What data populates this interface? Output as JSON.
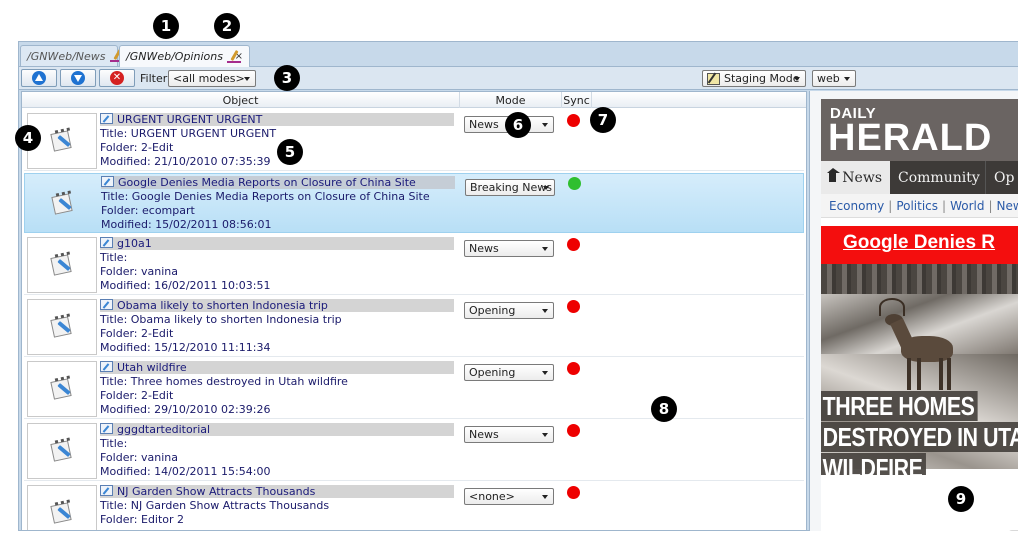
{
  "callouts": [
    "1",
    "2",
    "3",
    "4",
    "5",
    "6",
    "7",
    "8",
    "9"
  ],
  "tabs": [
    {
      "label": "/GNWeb/News",
      "active": false
    },
    {
      "label": "/GNWeb/Opinions",
      "active": true,
      "close": "×"
    }
  ],
  "toolbar": {
    "move_up_icon": "arrow-up-icon",
    "move_down_icon": "arrow-down-icon",
    "stop_icon": "stop-icon",
    "stop_glyph": "✕",
    "filter_label": "Filter:",
    "filter_value": "<all modes>",
    "staging_label": "Staging Mode",
    "channel_value": "web"
  },
  "columns": {
    "object": "Object",
    "mode": "Mode",
    "sync": "Sync"
  },
  "rows": [
    {
      "title": "URGENT URGENT URGENT",
      "title_line": "Title: URGENT URGENT URGENT",
      "folder": "Folder: 2-Edit",
      "modified": "Modified: 21/10/2010 07:35:39",
      "mode": "News",
      "sync": "red",
      "selected": false
    },
    {
      "title": "Google Denies Media Reports on Closure of China Site",
      "title_line": "Title: Google Denies Media Reports on Closure of China Site",
      "folder": "Folder: ecompart",
      "modified": "Modified: 15/02/2011 08:56:01",
      "mode": "Breaking News",
      "sync": "green",
      "selected": true
    },
    {
      "title": "g10a1",
      "title_line": "Title:",
      "folder": "Folder: vanina",
      "modified": "Modified: 16/02/2011 10:03:51",
      "mode": "News",
      "sync": "red",
      "selected": false
    },
    {
      "title": "Obama likely to shorten Indonesia trip",
      "title_line": "Title: Obama likely to shorten Indonesia trip",
      "folder": "Folder: 2-Edit",
      "modified": "Modified: 15/12/2010 11:11:34",
      "mode": "Opening",
      "sync": "red",
      "selected": false
    },
    {
      "title": "Utah wildfire",
      "title_line": "Title: Three homes destroyed in Utah wildfire",
      "folder": "Folder: 2-Edit",
      "modified": "Modified: 29/10/2010 02:39:26",
      "mode": "Opening",
      "sync": "red",
      "selected": false
    },
    {
      "title": "gggdtarteditorial",
      "title_line": "Title:",
      "folder": "Folder: vanina",
      "modified": "Modified: 14/02/2011 15:54:00",
      "mode": "News",
      "sync": "red",
      "selected": false
    },
    {
      "title": "NJ Garden Show Attracts Thousands",
      "title_line": "Title: NJ Garden Show Attracts Thousands",
      "folder": "Folder: Editor 2",
      "modified": "",
      "mode": "<none>",
      "sync": "red",
      "selected": false
    }
  ],
  "preview": {
    "masthead_small": "DAILY",
    "masthead_large": "HERALD",
    "nav": [
      "News",
      "Community",
      "Op"
    ],
    "subnav": [
      "Economy",
      "Politics",
      "World",
      "News C"
    ],
    "headline": "Google Denies R",
    "captions": [
      "THREE HOMES",
      "DESTROYED IN UTA",
      "WILDFIRE"
    ]
  },
  "colors": {
    "sync_red": "#ee0000",
    "sync_green": "#2fbf2f",
    "selection": "#b8dff6",
    "headline_red": "#f40e0e"
  }
}
